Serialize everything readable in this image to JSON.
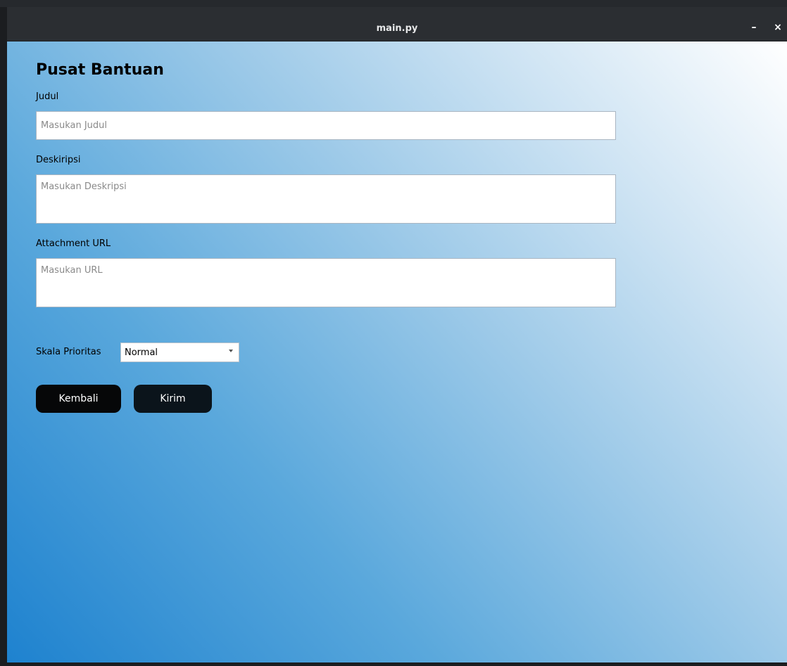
{
  "window": {
    "title": "main.py",
    "minimize_symbol": "–",
    "close_symbol": "×"
  },
  "form": {
    "heading": "Pusat Bantuan",
    "judul_label": "Judul",
    "judul_placeholder": "Masukan Judul",
    "judul_value": "",
    "deskripsi_label": "Deskiripsi",
    "deskripsi_placeholder": "Masukan Deskripsi",
    "deskripsi_value": "",
    "url_label": "Attachment URL",
    "url_placeholder": "Masukan URL",
    "url_value": "",
    "priority_label": "Skala Prioritas",
    "priority_selected": "Normal",
    "back_button": "Kembali",
    "submit_button": "Kirim"
  },
  "colors": {
    "titlebar": "#2b2e32",
    "gradient_start": "#1e82cf",
    "gradient_end": "#ffffff",
    "button": "#060708"
  }
}
